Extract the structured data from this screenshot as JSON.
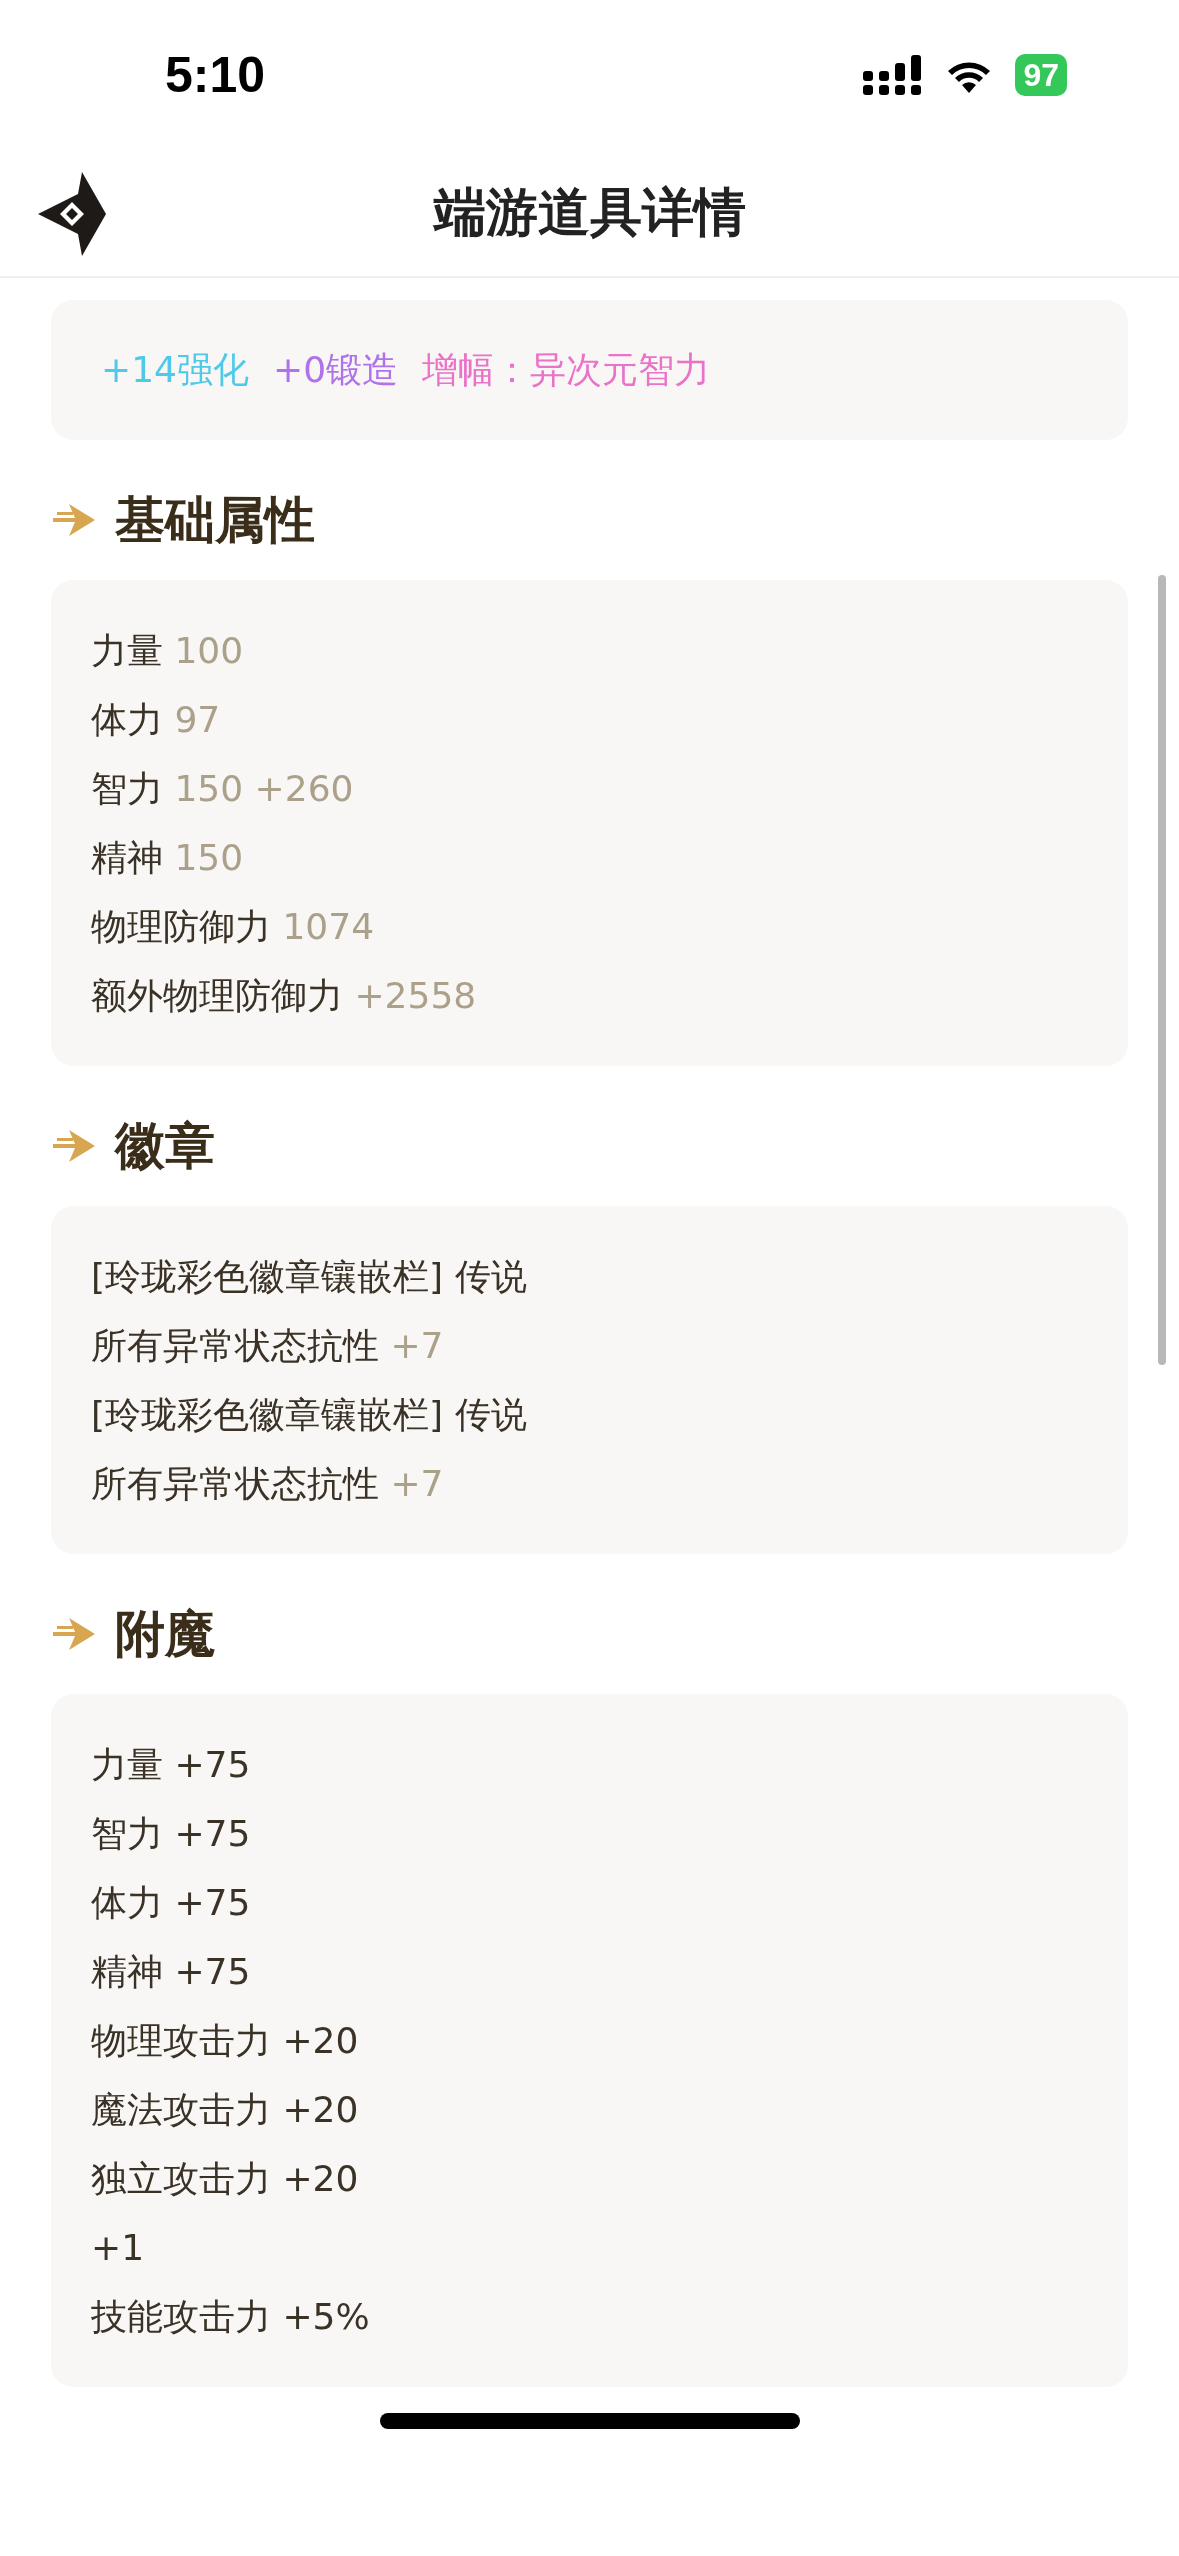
{
  "status_bar": {
    "time": "5:10",
    "battery": "97"
  },
  "header": {
    "title": "端游道具详情"
  },
  "tags": [
    {
      "text": "+14强化",
      "color": "#4ec9ea"
    },
    {
      "text": "+0锻造",
      "color": "#b072ea"
    },
    {
      "text": "增幅：异次元智力",
      "color": "#ea72c8"
    }
  ],
  "sections": [
    {
      "title": "基础属性",
      "kind": "muted",
      "rows": [
        {
          "label": "力量",
          "value": "100"
        },
        {
          "label": "体力",
          "value": "97"
        },
        {
          "label": "智力",
          "value": "150 +260"
        },
        {
          "label": "精神",
          "value": "150"
        },
        {
          "label": "物理防御力",
          "value": "1074"
        },
        {
          "label": "额外物理防御力",
          "value": "+2558"
        }
      ]
    },
    {
      "title": "徽章",
      "kind": "muted",
      "rows": [
        {
          "label": "[玲珑彩色徽章镶嵌栏] 传说"
        },
        {
          "label": "所有异常状态抗性",
          "value": "+7"
        },
        {
          "label": "[玲珑彩色徽章镶嵌栏] 传说"
        },
        {
          "label": "所有异常状态抗性",
          "value": "+7"
        }
      ]
    },
    {
      "title": "附魔",
      "kind": "plain",
      "rows": [
        {
          "label": "力量",
          "value": "+75"
        },
        {
          "label": "智力",
          "value": "+75"
        },
        {
          "label": "体力",
          "value": "+75"
        },
        {
          "label": "精神",
          "value": "+75"
        },
        {
          "label": "物理攻击力",
          "value": "+20"
        },
        {
          "label": "魔法攻击力",
          "value": "+20"
        },
        {
          "label": "独立攻击力",
          "value": "+20"
        },
        {
          "label": "+1"
        },
        {
          "label": "技能攻击力",
          "value": "+5%"
        }
      ]
    }
  ]
}
